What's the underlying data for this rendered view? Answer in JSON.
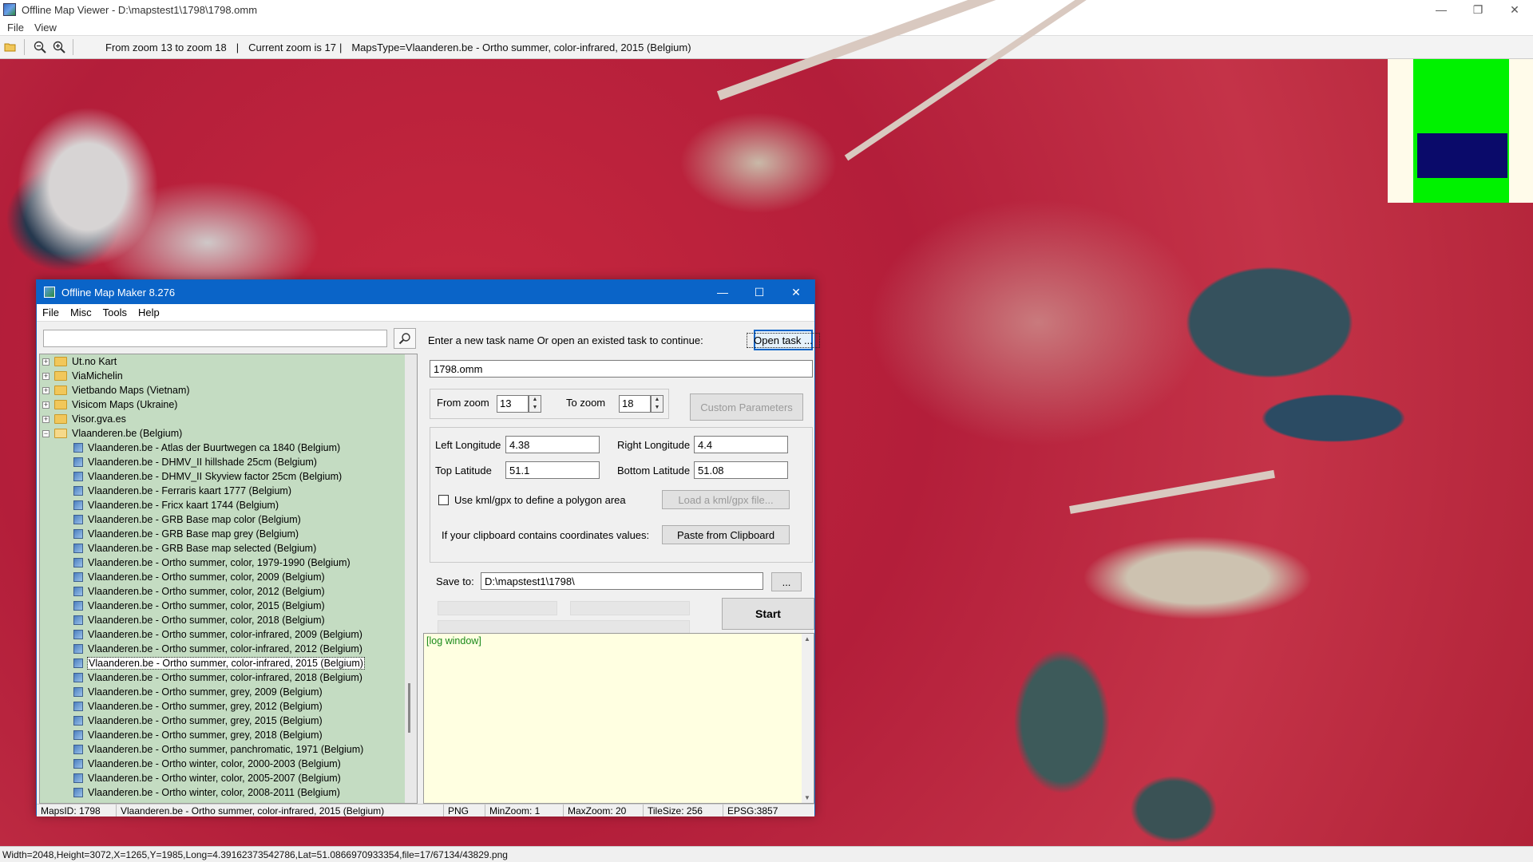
{
  "viewer": {
    "title": "Offline Map Viewer - D:\\mapstest1\\1798\\1798.omm",
    "menu": [
      "File",
      "View"
    ],
    "toolbar": {
      "zoom_range": "From zoom 13 to zoom 18",
      "current_zoom": "Current zoom is 17",
      "maps_type": "MapsType=Vlaanderen.be - Ortho summer, color-infrared, 2015 (Belgium)",
      "sep": "|"
    },
    "status": "Width=2048,Height=3072,X=1265,Y=1985,Long=4.39162373542786,Lat=51.0866970933354,file=17/67134/43829.png",
    "window_controls": {
      "minimize": "—",
      "maximize": "❐",
      "close": "✕"
    }
  },
  "dialog": {
    "title": "Offline Map Maker 8.276",
    "menu": [
      "File",
      "Misc",
      "Tools",
      "Help"
    ],
    "controls": {
      "minimize": "—",
      "maximize": "☐",
      "close": "✕"
    },
    "search": {
      "value": "",
      "icon": "search-icon"
    },
    "tree": {
      "folders_collapsed": [
        "Ut.no Kart",
        "ViaMichelin",
        "Vietbando Maps (Vietnam)",
        "Visicom Maps (Ukraine)",
        "Visor.gva.es"
      ],
      "open_folder": "Vlaanderen.be (Belgium)",
      "children": [
        "Vlaanderen.be - Atlas der Buurtwegen ca 1840 (Belgium)",
        "Vlaanderen.be - DHMV_II hillshade 25cm (Belgium)",
        "Vlaanderen.be - DHMV_II Skyview factor 25cm (Belgium)",
        "Vlaanderen.be - Ferraris kaart 1777 (Belgium)",
        "Vlaanderen.be - Fricx kaart 1744 (Belgium)",
        "Vlaanderen.be - GRB Base map color (Belgium)",
        "Vlaanderen.be - GRB Base map grey (Belgium)",
        "Vlaanderen.be - GRB Base map selected (Belgium)",
        "Vlaanderen.be - Ortho summer, color, 1979-1990 (Belgium)",
        "Vlaanderen.be - Ortho summer, color, 2009 (Belgium)",
        "Vlaanderen.be - Ortho summer, color, 2012 (Belgium)",
        "Vlaanderen.be - Ortho summer, color, 2015 (Belgium)",
        "Vlaanderen.be - Ortho summer, color, 2018 (Belgium)",
        "Vlaanderen.be - Ortho summer, color-infrared, 2009 (Belgium)",
        "Vlaanderen.be - Ortho summer, color-infrared, 2012 (Belgium)",
        "Vlaanderen.be - Ortho summer, color-infrared, 2015 (Belgium)",
        "Vlaanderen.be - Ortho summer, color-infrared, 2018 (Belgium)",
        "Vlaanderen.be - Ortho summer, grey, 2009 (Belgium)",
        "Vlaanderen.be - Ortho summer, grey, 2012 (Belgium)",
        "Vlaanderen.be - Ortho summer, grey, 2015 (Belgium)",
        "Vlaanderen.be - Ortho summer, grey, 2018 (Belgium)",
        "Vlaanderen.be - Ortho summer, panchromatic, 1971 (Belgium)",
        "Vlaanderen.be - Ortho winter, color, 2000-2003 (Belgium)",
        "Vlaanderen.be - Ortho winter, color, 2005-2007 (Belgium)",
        "Vlaanderen.be - Ortho winter, color, 2008-2011 (Belgium)"
      ],
      "selected_index": 15
    },
    "task": {
      "prompt": "Enter a new task name Or open an existed task to continue:",
      "open_button": "Open task ...",
      "name_value": "1798.omm"
    },
    "zoom": {
      "from_label": "From zoom",
      "from_value": "13",
      "to_label": "To zoom",
      "to_value": "18",
      "custom_button": "Custom Parameters"
    },
    "coords": {
      "left_lon_label": "Left Longitude",
      "left_lon": "4.38",
      "right_lon_label": "Right Longitude",
      "right_lon": "4.4",
      "top_lat_label": "Top Latitude",
      "top_lat": "51.1",
      "bottom_lat_label": "Bottom Latitude",
      "bottom_lat": "51.08",
      "kml_label": "Use kml/gpx to define a polygon area",
      "kml_button": "Load a kml/gpx file...",
      "clipboard_label": "If your clipboard contains coordinates values:",
      "clipboard_button": "Paste from Clipboard"
    },
    "save": {
      "label": "Save to:",
      "value": "D:\\mapstest1\\1798\\",
      "browse": "..."
    },
    "start_button": "Start",
    "log": "[log window]",
    "status": {
      "maps_id": "MapsID: 1798",
      "map_name": "Vlaanderen.be - Ortho summer, color-infrared, 2015 (Belgium)",
      "format": "PNG",
      "min_zoom": "MinZoom: 1",
      "max_zoom": "MaxZoom: 20",
      "tile_size": "TileSize: 256",
      "epsg": "EPSG:3857"
    }
  }
}
